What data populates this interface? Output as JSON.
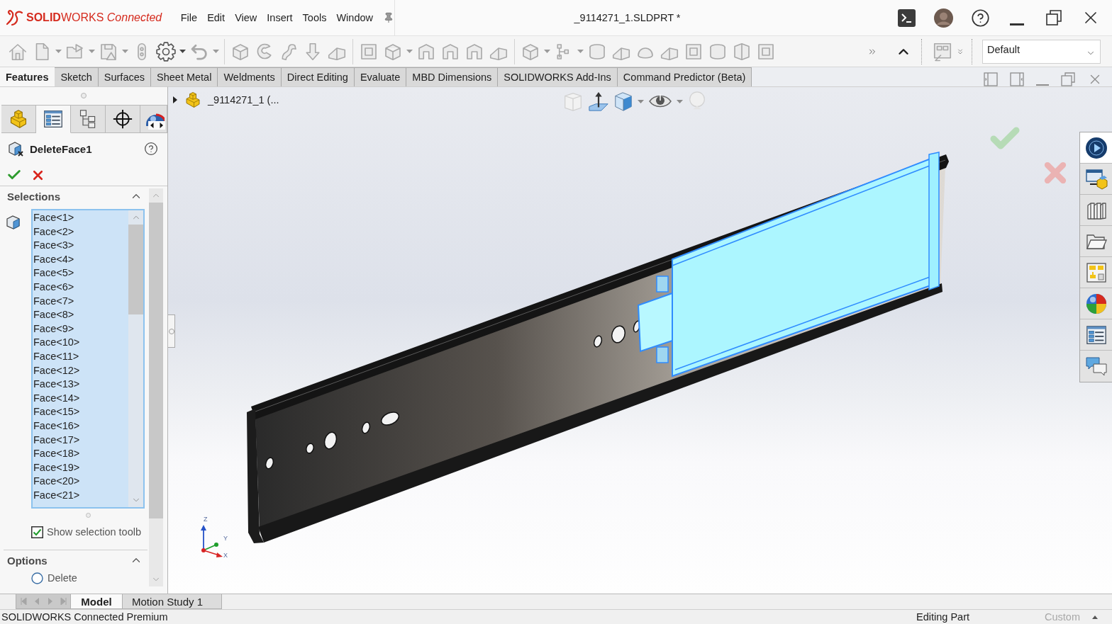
{
  "title_bar": {
    "logo": "**SOLID**WORKS *Connected*",
    "menu": [
      "File",
      "Edit",
      "View",
      "Insert",
      "Tools",
      "Window"
    ],
    "document_title": "_9114271_1.SLDPRT *"
  },
  "toolbar": {
    "configuration": "Default"
  },
  "command_tabs": [
    {
      "label": "Features",
      "selected": true
    },
    {
      "label": "Sketch",
      "selected": false
    },
    {
      "label": "Surfaces",
      "selected": false
    },
    {
      "label": "Sheet Metal",
      "selected": false
    },
    {
      "label": "Weldments",
      "selected": false
    },
    {
      "label": "Direct Editing",
      "selected": false
    },
    {
      "label": "Evaluate",
      "selected": false
    },
    {
      "label": "MBD Dimensions",
      "selected": false
    },
    {
      "label": "SOLIDWORKS Add-Ins",
      "selected": false
    },
    {
      "label": "Command Predictor (Beta)",
      "selected": false
    }
  ],
  "manager_tabs": [
    {
      "kind": "feature-tree",
      "selected": false
    },
    {
      "kind": "property",
      "selected": true
    },
    {
      "kind": "configuration",
      "selected": false
    },
    {
      "kind": "dimxpert",
      "selected": false
    },
    {
      "kind": "appearance",
      "selected": false
    }
  ],
  "property_manager": {
    "title": "DeleteFace1",
    "selections": {
      "title": "Selections",
      "expanded": true,
      "items": [
        "Face<1>",
        "Face<2>",
        "Face<3>",
        "Face<4>",
        "Face<5>",
        "Face<6>",
        "Face<7>",
        "Face<8>",
        "Face<9>",
        "Face<10>",
        "Face<11>",
        "Face<12>",
        "Face<13>",
        "Face<14>",
        "Face<15>",
        "Face<16>",
        "Face<17>",
        "Face<18>",
        "Face<19>",
        "Face<20>",
        "Face<21>"
      ],
      "show_toolbar": {
        "label": "Show selection toolb",
        "checked": true
      }
    },
    "options": {
      "title": "Options",
      "expanded": true,
      "choices": [
        {
          "label": "Delete",
          "selected": false
        }
      ]
    }
  },
  "viewport": {
    "tree_node": "_9114271_1 (...",
    "axes": [
      "Z",
      "Y",
      "X"
    ]
  },
  "task_pane": [
    {
      "kind": "marketplace",
      "selected": true
    },
    {
      "kind": "resources",
      "selected": false
    },
    {
      "kind": "library",
      "selected": false
    },
    {
      "kind": "file-explorer",
      "selected": false
    },
    {
      "kind": "view-palette",
      "selected": false
    },
    {
      "kind": "appearances",
      "selected": false
    },
    {
      "kind": "custom-properties",
      "selected": false
    },
    {
      "kind": "forum",
      "selected": false
    }
  ],
  "bottom_tabs": [
    {
      "label": "Model",
      "selected": true
    },
    {
      "label": "Motion Study 1",
      "selected": false
    }
  ],
  "status_bar": {
    "product": "SOLIDWORKS Connected Premium",
    "mode": "Editing Part",
    "units": "Custom"
  }
}
